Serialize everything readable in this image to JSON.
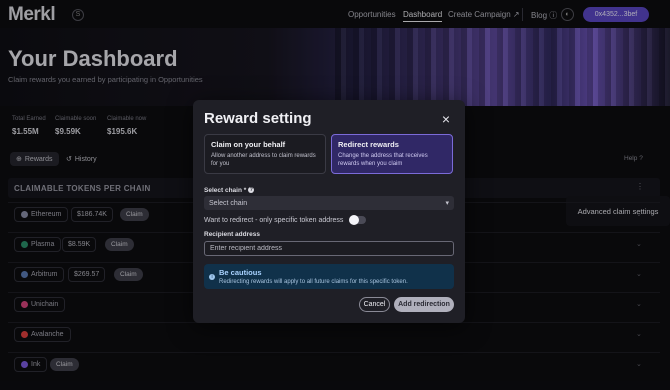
{
  "header": {
    "logo": "Merkl",
    "logo_badge": "S",
    "nav": [
      "Opportunities",
      "Dashboard",
      "Create Campaign ↗"
    ],
    "blog": "Blog ⓘ",
    "theme_icon": "◐",
    "wallet": "0x4352...3bef"
  },
  "page": {
    "title": "Your Dashboard",
    "subtitle": "Claim rewards you earned by participating in Opportunities"
  },
  "stats": [
    {
      "label": "Total Earned",
      "value": "$1.55M"
    },
    {
      "label": "Claimable soon",
      "value": "$9.59K"
    },
    {
      "label": "Claimable now",
      "value": "$195.6K"
    }
  ],
  "tabs": {
    "rewards": "Rewards",
    "history": "History",
    "help": "Help"
  },
  "section": {
    "title": "CLAIMABLE TOKENS PER CHAIN",
    "menu_item": "Advanced claim settings"
  },
  "chains": [
    {
      "name": "Ethereum",
      "amount": "$186.74K",
      "claim": "Claim",
      "color": "#8b8fa8"
    },
    {
      "name": "Plasma",
      "amount": "$8.59K",
      "claim": "Claim",
      "color": "#2c8f6a"
    },
    {
      "name": "Arbitrum",
      "amount": "$269.57",
      "claim": "Claim",
      "color": "#5b7bb3"
    },
    {
      "name": "Unichain",
      "amount": "",
      "claim": "",
      "color": "#d6457c"
    },
    {
      "name": "Avalanche",
      "amount": "",
      "claim": "",
      "color": "#e0413f"
    },
    {
      "name": "Ink",
      "amount": "",
      "claim": "Claim",
      "color": "#7d5ce0"
    }
  ],
  "modal": {
    "title": "Reward setting",
    "close_icon": "×",
    "option_left": {
      "title": "Claim on your behalf",
      "desc": "Allow another address to claim rewards for you"
    },
    "option_right": {
      "title": "Redirect rewards",
      "desc": "Change the address that receives rewards when you claim"
    },
    "select_label": "Select chain *",
    "select_value": "Select chain",
    "toggle_label": "Want to redirect - only specific token address",
    "recipient_label": "Recipient address",
    "recipient_placeholder": "Enter recipient address",
    "alert_title": "Be cautious",
    "alert_text": "Redirecting rewards will apply to all future claims for this specific token.",
    "cancel": "Cancel",
    "submit": "Add redirection"
  },
  "colors": {
    "accent": "#5b47c4",
    "alert_bg": "#10314a"
  }
}
